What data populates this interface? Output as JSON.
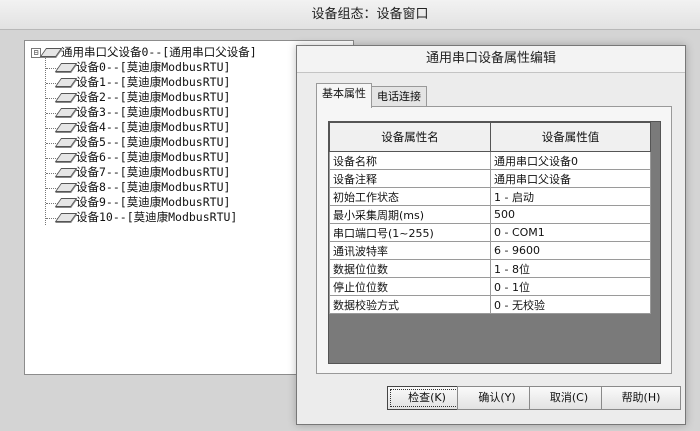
{
  "window": {
    "title": "设备组态：设备窗口"
  },
  "tree": {
    "root": {
      "expander": "⊟",
      "label": "通用串口父设备0--[通用串口父设备]"
    },
    "children": [
      "设备0--[莫迪康ModbusRTU]",
      "设备1--[莫迪康ModbusRTU]",
      "设备2--[莫迪康ModbusRTU]",
      "设备3--[莫迪康ModbusRTU]",
      "设备4--[莫迪康ModbusRTU]",
      "设备5--[莫迪康ModbusRTU]",
      "设备6--[莫迪康ModbusRTU]",
      "设备7--[莫迪康ModbusRTU]",
      "设备8--[莫迪康ModbusRTU]",
      "设备9--[莫迪康ModbusRTU]",
      "设备10--[莫迪康ModbusRTU]"
    ]
  },
  "dialog": {
    "title": "通用串口设备属性编辑",
    "tabs": [
      "基本属性",
      "电话连接"
    ],
    "grid": {
      "headers": [
        "设备属性名",
        "设备属性值"
      ],
      "rows": [
        [
          "设备名称",
          "通用串口父设备0"
        ],
        [
          "设备注释",
          "通用串口父设备"
        ],
        [
          "初始工作状态",
          "1 - 启动"
        ],
        [
          "最小采集周期(ms)",
          "500"
        ],
        [
          "串口端口号(1~255)",
          "0 - COM1"
        ],
        [
          "通讯波特率",
          "6 - 9600"
        ],
        [
          "数据位位数",
          "1 - 8位"
        ],
        [
          "停止位位数",
          "0 - 1位"
        ],
        [
          "数据校验方式",
          "0 - 无校验"
        ]
      ]
    },
    "buttons": {
      "check": "检查(K)",
      "ok": "确认(Y)",
      "cancel": "取消(C)",
      "help": "帮助(H)"
    }
  }
}
